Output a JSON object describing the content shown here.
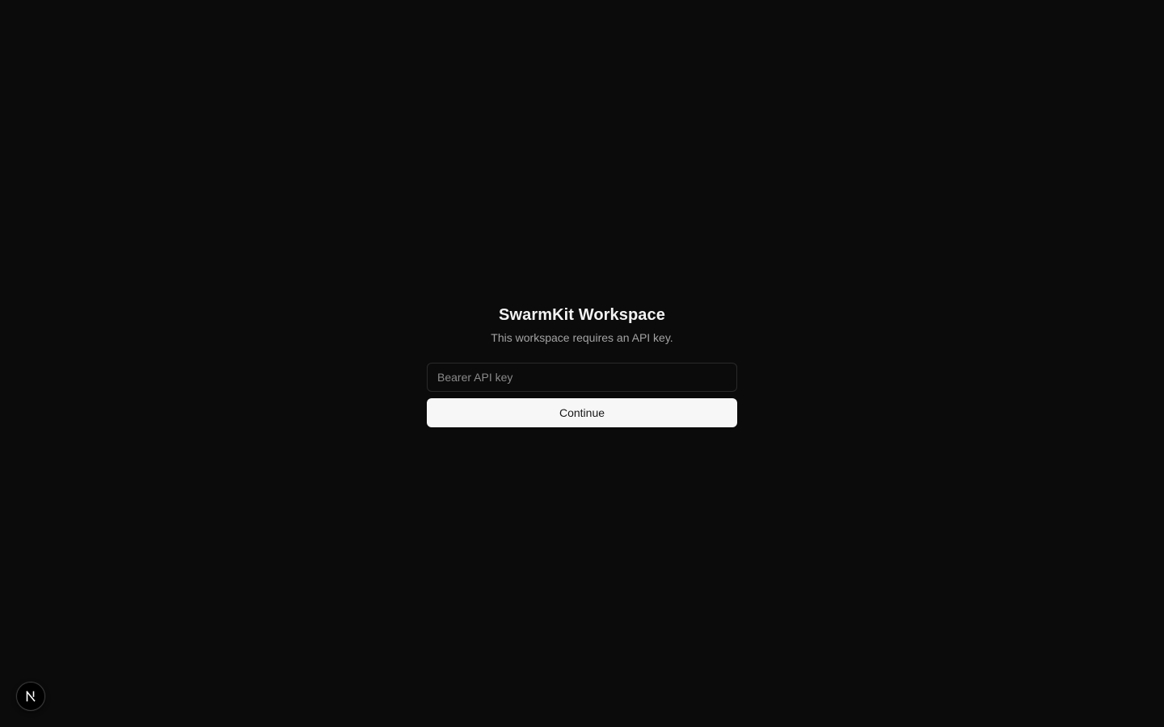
{
  "workspace": {
    "title": "SwarmKit Workspace",
    "subtitle": "This workspace requires an API key."
  },
  "api_key_field": {
    "value": "",
    "placeholder": "Bearer API key"
  },
  "continue_button": {
    "label": "Continue"
  },
  "dev_indicator": {
    "icon": "nextjs-logo-icon"
  },
  "colors": {
    "background": "#0b0b0b",
    "button_bg": "#f7f7f7",
    "button_text": "#171717",
    "subtitle": "#a3a3a3"
  }
}
